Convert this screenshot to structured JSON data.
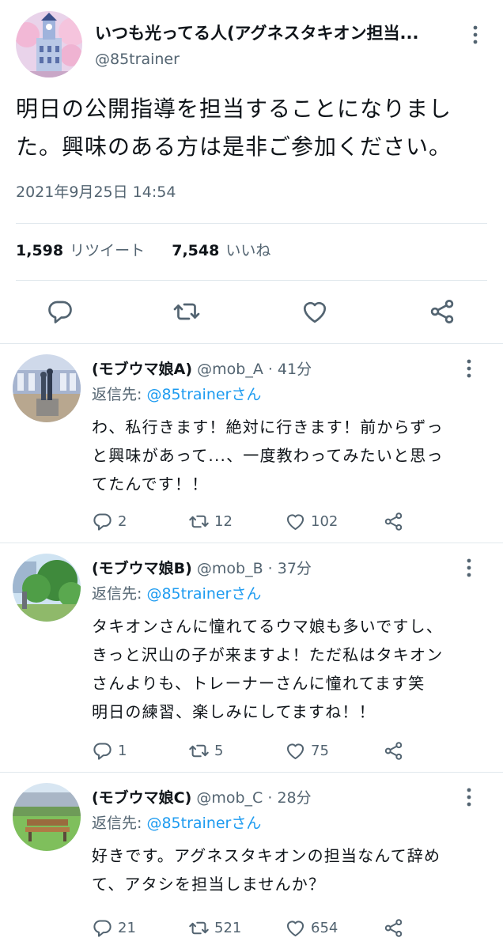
{
  "main_tweet": {
    "display_name": "いつも光ってる人(アグネスタキオン担当...",
    "handle": "@85trainer",
    "text_line1": "明日の公開指導を担当することになりまし",
    "text_line2": "た。興味のある方は是非ご参加ください。",
    "timestamp": "2021年9月25日 14:54",
    "retweet_count": "1,598",
    "retweet_label": "リツイート",
    "like_count": "7,548",
    "like_label": "いいね",
    "actions": [
      "reply-icon",
      "retweet-icon",
      "like-icon",
      "share-icon"
    ]
  },
  "replies": [
    {
      "display_name": "(モブウマ娘A)",
      "handle_time": "@mob_A · 41分",
      "reply_to_prefix": "返信先: ",
      "reply_to_handle": "@85trainerさん",
      "lines": [
        "わ、私行きます！絶対に行きます！前からずっ",
        "と興味があって...、一度教わってみたいと思っ",
        "てたんです！！"
      ],
      "reply_count": "2",
      "retweet_count": "12",
      "like_count": "102"
    },
    {
      "display_name": "(モブウマ娘B)",
      "handle_time": "@mob_B · 37分",
      "reply_to_prefix": "返信先: ",
      "reply_to_handle": "@85trainerさん",
      "lines": [
        "タキオンさんに憧れてるウマ娘も多いですし、",
        "きっと沢山の子が来ますよ！ただ私はタキオン",
        "さんよりも、トレーナーさんに憧れてます笑",
        "明日の練習、楽しみにしてますね！！"
      ],
      "reply_count": "1",
      "retweet_count": "5",
      "like_count": "75"
    },
    {
      "display_name": "(モブウマ娘C)",
      "handle_time": "@mob_C · 28分",
      "reply_to_prefix": "返信先: ",
      "reply_to_handle": "@85trainerさん",
      "lines": [
        "好きです。アグネスタキオンの担当なんて辞め",
        "て、アタシを担当しませんか？"
      ],
      "reply_count": "21",
      "retweet_count": "521",
      "like_count": "654"
    }
  ],
  "colors": {
    "text": "#0f1419",
    "secondary": "#536471",
    "link": "#1d9bf0",
    "divider": "#e1e8ed"
  }
}
